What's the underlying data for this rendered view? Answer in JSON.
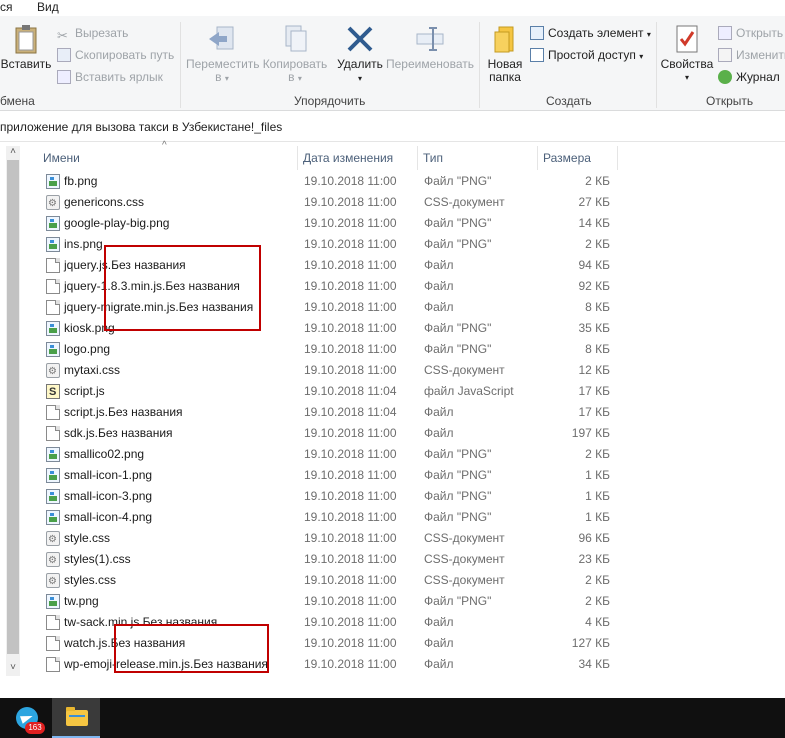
{
  "menubar": {
    "items": [
      "ся",
      "Вид"
    ]
  },
  "ribbon": {
    "clipboard": {
      "paste_label": "Вставить",
      "cut_label": "Вырезать",
      "copy_path_label": "Скопировать путь",
      "paste_shortcut_label": "Вставить ярлык",
      "group_label": "бмена"
    },
    "organize": {
      "move_label_1": "Переместить",
      "move_label_2": "в",
      "copy_label_1": "Копировать",
      "copy_label_2": "в",
      "delete_label": "Удалить",
      "rename_label": "Переименовать",
      "group_label": "Упорядочить"
    },
    "create": {
      "new_folder_label_1": "Новая",
      "new_folder_label_2": "папка",
      "new_item_label": "Создать элемент",
      "easy_access_label": "Простой доступ",
      "group_label": "Создать"
    },
    "open": {
      "properties_label": "Свойства",
      "open_label": "Открыть",
      "edit_label": "Изменить",
      "history_label": "Журнал",
      "group_label": "Открыть"
    }
  },
  "address": {
    "path": "приложение для вызова такси в Узбекистане!_files"
  },
  "columns": {
    "name": "Имени",
    "date": "Дата изменения",
    "type": "Тип",
    "size": "Размера"
  },
  "files": [
    {
      "name": "fb.png",
      "date": "19.10.2018 11:00",
      "type": "Файл \"PNG\"",
      "size": "2 КБ",
      "icon": "png"
    },
    {
      "name": "genericons.css",
      "date": "19.10.2018 11:00",
      "type": "CSS-документ",
      "size": "27 КБ",
      "icon": "css"
    },
    {
      "name": "google-play-big.png",
      "date": "19.10.2018 11:00",
      "type": "Файл \"PNG\"",
      "size": "14 КБ",
      "icon": "png"
    },
    {
      "name": "ins.png",
      "date": "19.10.2018 11:00",
      "type": "Файл \"PNG\"",
      "size": "2 КБ",
      "icon": "png"
    },
    {
      "name": "jquery.js.Без названия",
      "date": "19.10.2018 11:00",
      "type": "Файл",
      "size": "94 КБ",
      "icon": "file"
    },
    {
      "name": "jquery-1.8.3.min.js.Без названия",
      "date": "19.10.2018 11:00",
      "type": "Файл",
      "size": "92 КБ",
      "icon": "file"
    },
    {
      "name": "jquery-migrate.min.js.Без названия",
      "date": "19.10.2018 11:00",
      "type": "Файл",
      "size": "8 КБ",
      "icon": "file"
    },
    {
      "name": "kiosk.png",
      "date": "19.10.2018 11:00",
      "type": "Файл \"PNG\"",
      "size": "35 КБ",
      "icon": "png"
    },
    {
      "name": "logo.png",
      "date": "19.10.2018 11:00",
      "type": "Файл \"PNG\"",
      "size": "8 КБ",
      "icon": "png"
    },
    {
      "name": "mytaxi.css",
      "date": "19.10.2018 11:00",
      "type": "CSS-документ",
      "size": "12 КБ",
      "icon": "css"
    },
    {
      "name": "script.js",
      "date": "19.10.2018 11:04",
      "type": "файл JavaScript",
      "size": "17 КБ",
      "icon": "js"
    },
    {
      "name": "script.js.Без названия",
      "date": "19.10.2018 11:04",
      "type": "Файл",
      "size": "17 КБ",
      "icon": "file"
    },
    {
      "name": "sdk.js.Без названия",
      "date": "19.10.2018 11:00",
      "type": "Файл",
      "size": "197 КБ",
      "icon": "file"
    },
    {
      "name": "smallico02.png",
      "date": "19.10.2018 11:00",
      "type": "Файл \"PNG\"",
      "size": "2 КБ",
      "icon": "png"
    },
    {
      "name": "small-icon-1.png",
      "date": "19.10.2018 11:00",
      "type": "Файл \"PNG\"",
      "size": "1 КБ",
      "icon": "png"
    },
    {
      "name": "small-icon-3.png",
      "date": "19.10.2018 11:00",
      "type": "Файл \"PNG\"",
      "size": "1 КБ",
      "icon": "png"
    },
    {
      "name": "small-icon-4.png",
      "date": "19.10.2018 11:00",
      "type": "Файл \"PNG\"",
      "size": "1 КБ",
      "icon": "png"
    },
    {
      "name": "style.css",
      "date": "19.10.2018 11:00",
      "type": "CSS-документ",
      "size": "96 КБ",
      "icon": "css"
    },
    {
      "name": "styles(1).css",
      "date": "19.10.2018 11:00",
      "type": "CSS-документ",
      "size": "23 КБ",
      "icon": "css"
    },
    {
      "name": "styles.css",
      "date": "19.10.2018 11:00",
      "type": "CSS-документ",
      "size": "2 КБ",
      "icon": "css"
    },
    {
      "name": "tw.png",
      "date": "19.10.2018 11:00",
      "type": "Файл \"PNG\"",
      "size": "2 КБ",
      "icon": "png"
    },
    {
      "name": "tw-sack.min.js.Без названия",
      "date": "19.10.2018 11:00",
      "type": "Файл",
      "size": "4 КБ",
      "icon": "file"
    },
    {
      "name": "watch.js.Без названия",
      "date": "19.10.2018 11:00",
      "type": "Файл",
      "size": "127 КБ",
      "icon": "file"
    },
    {
      "name": "wp-emoji-release.min.js.Без названия",
      "date": "19.10.2018 11:00",
      "type": "Файл",
      "size": "34 КБ",
      "icon": "file"
    }
  ],
  "taskbar": {
    "telegram_badge": "163"
  },
  "colors": {
    "highlight": "#c00000",
    "header_text": "#4c607a"
  }
}
